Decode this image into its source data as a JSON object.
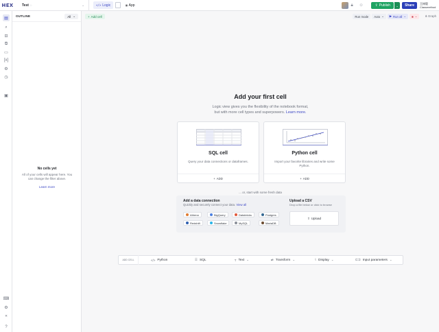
{
  "app": {
    "logo": "HEX"
  },
  "project": {
    "name": "Test"
  },
  "modes": {
    "logic": "Logic",
    "app": "App"
  },
  "header": {
    "publish": "Publish",
    "share": "Share",
    "user_name": "王梓毅",
    "user_org": "Classmethod"
  },
  "outline": {
    "title": "OUTLINE",
    "filter": "All",
    "empty_title": "No cells yet",
    "empty_desc": "All of your cells will appear here. You can change the filter above.",
    "learn_more": "Learn more"
  },
  "toolbar": {
    "add_cell": "Add cell",
    "run_mode_label": "Run mode",
    "run_mode_value": "Auto",
    "run_all": "Run all",
    "graph": "Graph"
  },
  "hero": {
    "title": "Add your first cell",
    "subtitle_1": "Logic view gives you the flexibility of the notebook format,",
    "subtitle_2": "but with more cell types and superpowers.",
    "learn_more": "Learn more."
  },
  "cards": [
    {
      "title": "SQL cell",
      "desc": "Query your data connections or dataframes.",
      "add": "ADD"
    },
    {
      "title": "Python cell",
      "desc": "Import your favorite libraries and write some Python.",
      "add": "ADD"
    }
  ],
  "fresh": "... or, start with some fresh data",
  "data_connection": {
    "title": "Add a data connection",
    "subtitle": "Quickly and securely connect your data.",
    "view_all": "View all",
    "sources": [
      {
        "name": "Athena",
        "color": "#e07a2f"
      },
      {
        "name": "BigQuery",
        "color": "#4a7fe0"
      },
      {
        "name": "Databricks",
        "color": "#e0573a"
      },
      {
        "name": "Postgres",
        "color": "#336791"
      },
      {
        "name": "Redshift",
        "color": "#2f5fb0"
      },
      {
        "name": "Snowflake",
        "color": "#29b5e8"
      },
      {
        "name": "MySQL",
        "color": "#8a8f99"
      },
      {
        "name": "MariaDB",
        "color": "#6b4a2f"
      }
    ]
  },
  "csv": {
    "title": "Upload a CSV",
    "subtitle": "Drop a file below or click to browse",
    "upload": "Upload"
  },
  "add_bar": {
    "label": "ADD CELL",
    "items": [
      {
        "label": "Python",
        "icon": "code-icon"
      },
      {
        "label": "SQL",
        "icon": "database-icon"
      },
      {
        "label": "Text",
        "icon": "text-icon"
      },
      {
        "label": "Transform",
        "icon": "transform-icon"
      },
      {
        "label": "Display",
        "icon": "chart-icon"
      },
      {
        "label": "Input parameters",
        "icon": "input-icon"
      }
    ]
  },
  "colors": {
    "accent": "#3b46c4",
    "publish": "#1fa463",
    "share": "#2b3fb8"
  }
}
